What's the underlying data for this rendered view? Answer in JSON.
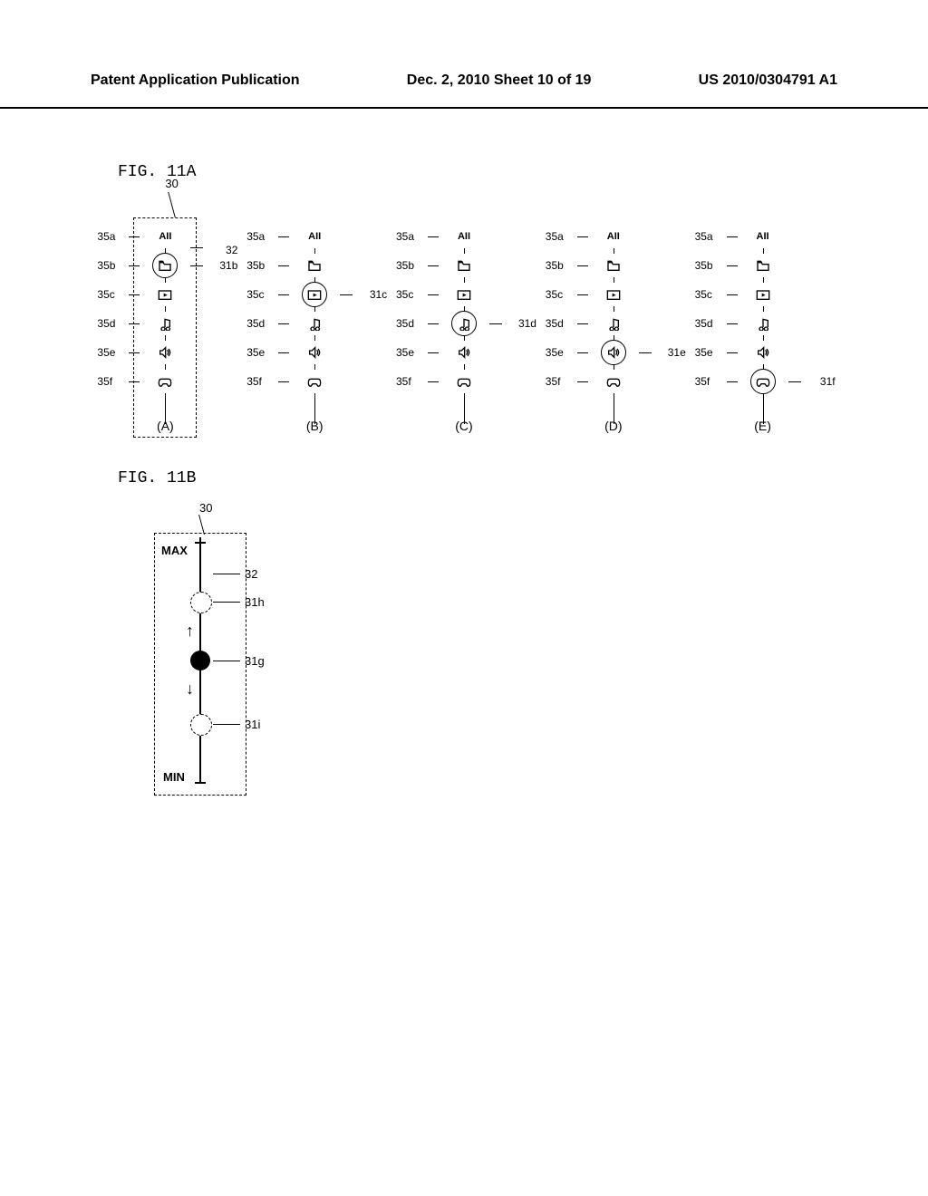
{
  "header": {
    "left": "Patent Application Publication",
    "center": "Dec. 2, 2010  Sheet 10 of 19",
    "right": "US 2010/0304791 A1"
  },
  "fig11a": {
    "title": "FIG. 11A",
    "ref30": "30",
    "ref32": "32",
    "labels": {
      "a": "35a",
      "b": "35b",
      "c": "35c",
      "d": "35d",
      "e": "35e",
      "f": "35f"
    },
    "text_icons": {
      "all": "AII"
    },
    "columns": [
      {
        "letter": "(A)",
        "circled_index": 1,
        "circled_ref": "31b",
        "show_box": true,
        "show_30": true
      },
      {
        "letter": "(B)",
        "circled_index": 2,
        "circled_ref": "31c"
      },
      {
        "letter": "(C)",
        "circled_index": 3,
        "circled_ref": "31d"
      },
      {
        "letter": "(D)",
        "circled_index": 4,
        "circled_ref": "31e"
      },
      {
        "letter": "(E)",
        "circled_index": 5,
        "circled_ref": "31f"
      }
    ]
  },
  "fig11b": {
    "title": "FIG. 11B",
    "ref30": "30",
    "ref32": "32",
    "max": "MAX",
    "min": "MIN",
    "refs": {
      "h": "31h",
      "g": "31g",
      "i": "31i"
    }
  }
}
